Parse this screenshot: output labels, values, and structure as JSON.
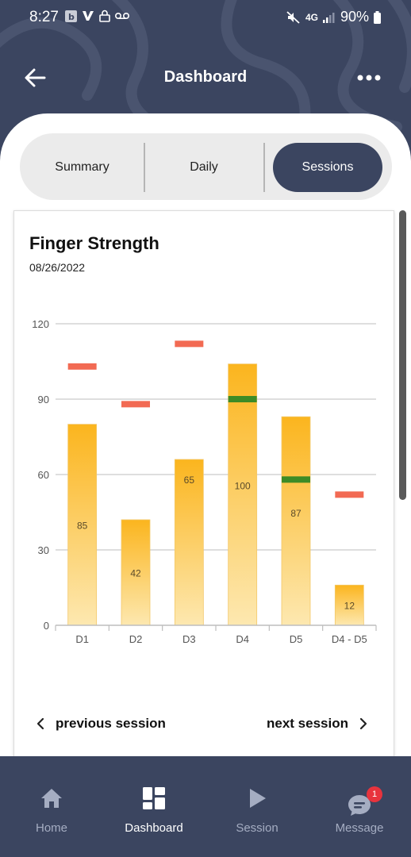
{
  "status_bar": {
    "time": "8:27",
    "battery": "90%",
    "network": "4G"
  },
  "app_bar": {
    "title": "Dashboard"
  },
  "tabs": [
    {
      "label": "Summary",
      "active": false
    },
    {
      "label": "Daily",
      "active": false
    },
    {
      "label": "Sessions",
      "active": true
    }
  ],
  "card": {
    "title": "Finger Strength",
    "date": "08/26/2022",
    "prev_label": "previous session",
    "next_label": "next session"
  },
  "chart_data": {
    "type": "bar",
    "categories": [
      "D1",
      "D2",
      "D3",
      "D4",
      "D5",
      "D4 - D5"
    ],
    "values": [
      80,
      42,
      66,
      104,
      83,
      16
    ],
    "data_labels": [
      "85",
      "42",
      "65",
      "100",
      "87",
      "12"
    ],
    "red_markers": [
      103,
      88,
      112,
      null,
      null,
      52
    ],
    "green_markers": [
      null,
      null,
      null,
      90,
      58,
      null
    ],
    "yticks": [
      "0",
      "30",
      "60",
      "90",
      "120"
    ],
    "ylim": [
      0,
      120
    ],
    "grid": true,
    "colors": {
      "bar_top": "#fbb51e",
      "bar_bottom": "#fde8b0",
      "red_marker": "#f26a53",
      "green_marker": "#3d8b26",
      "grid": "#d3d3d3"
    }
  },
  "bottom_nav": {
    "items": [
      {
        "label": "Home",
        "icon": "home-icon",
        "active": false
      },
      {
        "label": "Dashboard",
        "icon": "dashboard-icon",
        "active": true
      },
      {
        "label": "Session",
        "icon": "play-icon",
        "active": false
      },
      {
        "label": "Message",
        "icon": "chat-icon",
        "active": false,
        "badge": "1"
      }
    ]
  },
  "colors": {
    "primary": "#3b4560",
    "segment_bg": "#ebebeb"
  }
}
